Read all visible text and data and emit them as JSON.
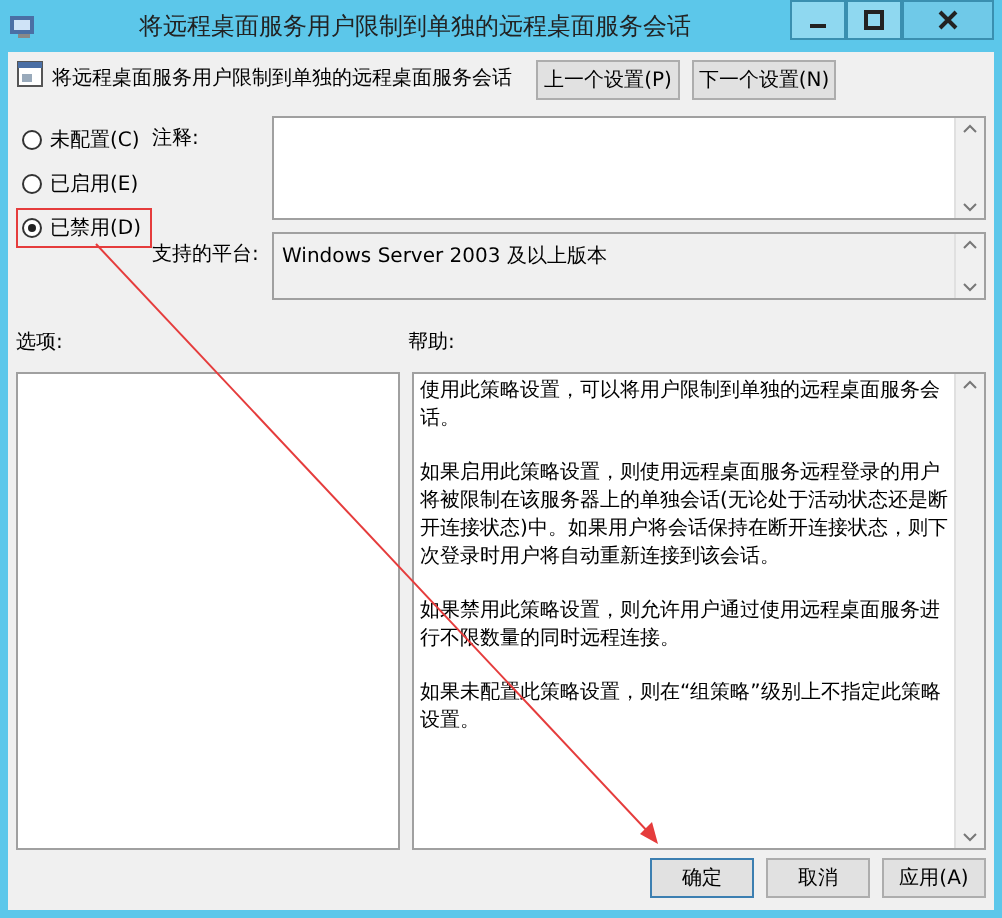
{
  "window": {
    "title": "将远程桌面服务用户限制到单独的远程桌面服务会话"
  },
  "setting_title": "将远程桌面服务用户限制到单独的远程桌面服务会话",
  "nav_buttons": [
    "上一个设置(P)",
    "下一个设置(N)"
  ],
  "options": [
    {
      "label": "未配置(C)",
      "selected": false,
      "highlighted": false
    },
    {
      "label": "已启用(E)",
      "selected": false,
      "highlighted": false
    },
    {
      "label": "已禁用(D)",
      "selected": true,
      "highlighted": true
    }
  ],
  "comment_label": "注释:",
  "platform_label": "支持的平台:",
  "platform_value": "Windows Server 2003 及以上版本",
  "options_label": "选项:",
  "help_label": "帮助:",
  "help_paragraphs": [
    "使用此策略设置，可以将用户限制到单独的远程桌面服务会话。",
    "如果启用此策略设置，则使用远程桌面服务远程登录的用户将被限制在该服务器上的单独会话(无论处于活动状态还是断开连接状态)中。如果用户将会话保持在断开连接状态，则下次登录时用户将自动重新连接到该会话。",
    "如果禁用此策略设置，则允许用户通过使用远程桌面服务进行不限数量的同时远程连接。",
    "如果未配置此策略设置，则在“组策略”级别上不指定此策略设置。"
  ],
  "buttons": [
    "确定",
    "取消",
    "应用(A)"
  ]
}
